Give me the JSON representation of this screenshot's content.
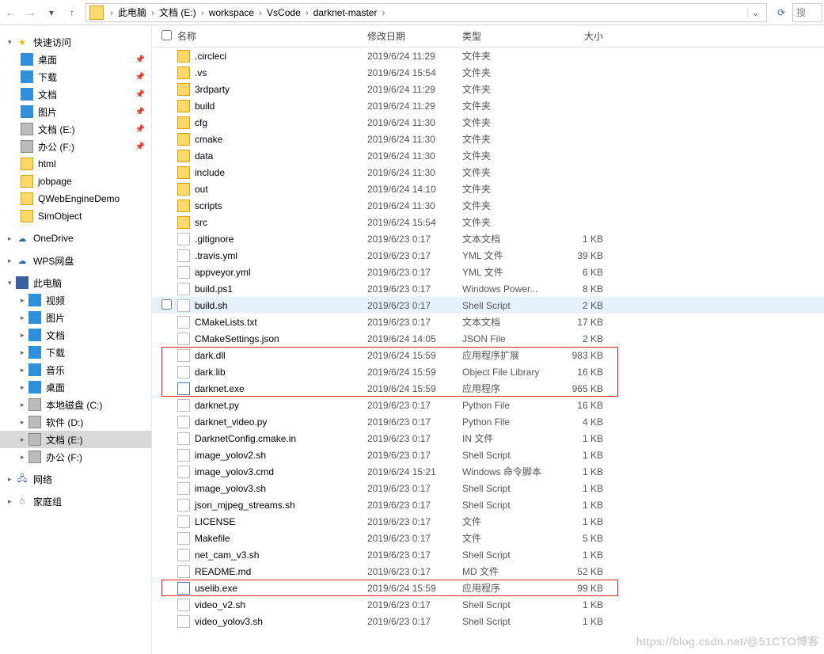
{
  "toolbar": {
    "breadcrumb": [
      "此电脑",
      "文档 (E:)",
      "workspace",
      "VsCode",
      "darknet-master"
    ],
    "search_placeholder": "搜索\""
  },
  "sidebar": {
    "quick_access": {
      "label": "快速访问",
      "items": [
        {
          "label": "桌面",
          "icon": "desktop",
          "pinned": true
        },
        {
          "label": "下载",
          "icon": "dl",
          "pinned": true
        },
        {
          "label": "文档",
          "icon": "doc",
          "pinned": true
        },
        {
          "label": "图片",
          "icon": "pic",
          "pinned": true
        },
        {
          "label": "文档 (E:)",
          "icon": "drive",
          "pinned": true
        },
        {
          "label": "办公 (F:)",
          "icon": "drive",
          "pinned": true
        },
        {
          "label": "html",
          "icon": "folder"
        },
        {
          "label": "jobpage",
          "icon": "folder"
        },
        {
          "label": "QWebEngineDemo",
          "icon": "folder"
        },
        {
          "label": "SimObject",
          "icon": "folder"
        }
      ]
    },
    "onedrive": {
      "label": "OneDrive"
    },
    "wps": {
      "label": "WPS网盘"
    },
    "this_pc": {
      "label": "此电脑",
      "items": [
        {
          "label": "视频",
          "icon": "pic"
        },
        {
          "label": "图片",
          "icon": "pic"
        },
        {
          "label": "文档",
          "icon": "doc"
        },
        {
          "label": "下载",
          "icon": "dl"
        },
        {
          "label": "音乐",
          "icon": "music"
        },
        {
          "label": "桌面",
          "icon": "desktop"
        },
        {
          "label": "本地磁盘 (C:)",
          "icon": "drive"
        },
        {
          "label": "软件 (D:)",
          "icon": "drive"
        },
        {
          "label": "文档 (E:)",
          "icon": "drive",
          "selected": true
        },
        {
          "label": "办公 (F:)",
          "icon": "drive"
        }
      ]
    },
    "network": {
      "label": "网络"
    },
    "homegroup": {
      "label": "家庭组"
    }
  },
  "columns": {
    "name": "名称",
    "date": "修改日期",
    "type": "类型",
    "size": "大小"
  },
  "files": [
    {
      "name": ".circleci",
      "date": "2019/6/24 11:29",
      "type": "文件夹",
      "size": "",
      "icon": "folder"
    },
    {
      "name": ".vs",
      "date": "2019/6/24 15:54",
      "type": "文件夹",
      "size": "",
      "icon": "folder"
    },
    {
      "name": "3rdparty",
      "date": "2019/6/24 11:29",
      "type": "文件夹",
      "size": "",
      "icon": "folder"
    },
    {
      "name": "build",
      "date": "2019/6/24 11:29",
      "type": "文件夹",
      "size": "",
      "icon": "folder"
    },
    {
      "name": "cfg",
      "date": "2019/6/24 11:30",
      "type": "文件夹",
      "size": "",
      "icon": "folder"
    },
    {
      "name": "cmake",
      "date": "2019/6/24 11:30",
      "type": "文件夹",
      "size": "",
      "icon": "folder"
    },
    {
      "name": "data",
      "date": "2019/6/24 11:30",
      "type": "文件夹",
      "size": "",
      "icon": "folder"
    },
    {
      "name": "include",
      "date": "2019/6/24 11:30",
      "type": "文件夹",
      "size": "",
      "icon": "folder"
    },
    {
      "name": "out",
      "date": "2019/6/24 14:10",
      "type": "文件夹",
      "size": "",
      "icon": "folder"
    },
    {
      "name": "scripts",
      "date": "2019/6/24 11:30",
      "type": "文件夹",
      "size": "",
      "icon": "folder"
    },
    {
      "name": "src",
      "date": "2019/6/24 15:54",
      "type": "文件夹",
      "size": "",
      "icon": "folder"
    },
    {
      "name": ".gitignore",
      "date": "2019/6/23 0:17",
      "type": "文本文档",
      "size": "1 KB",
      "icon": "txtfile"
    },
    {
      "name": ".travis.yml",
      "date": "2019/6/23 0:17",
      "type": "YML 文件",
      "size": "39 KB",
      "icon": "txtfile"
    },
    {
      "name": "appveyor.yml",
      "date": "2019/6/23 0:17",
      "type": "YML 文件",
      "size": "6 KB",
      "icon": "txtfile"
    },
    {
      "name": "build.ps1",
      "date": "2019/6/23 0:17",
      "type": "Windows Power...",
      "size": "8 KB",
      "icon": "shfile"
    },
    {
      "name": "build.sh",
      "date": "2019/6/23 0:17",
      "type": "Shell Script",
      "size": "2 KB",
      "icon": "shfile",
      "hovered": true
    },
    {
      "name": "CMakeLists.txt",
      "date": "2019/6/23 0:17",
      "type": "文本文档",
      "size": "17 KB",
      "icon": "txtfile"
    },
    {
      "name": "CMakeSettings.json",
      "date": "2019/6/24 14:05",
      "type": "JSON File",
      "size": "2 KB",
      "icon": "txtfile"
    },
    {
      "name": "dark.dll",
      "date": "2019/6/24 15:59",
      "type": "应用程序扩展",
      "size": "983 KB",
      "icon": "shfile"
    },
    {
      "name": "dark.lib",
      "date": "2019/6/24 15:59",
      "type": "Object File Library",
      "size": "16 KB",
      "icon": "shfile"
    },
    {
      "name": "darknet.exe",
      "date": "2019/6/24 15:59",
      "type": "应用程序",
      "size": "965 KB",
      "icon": "exefile"
    },
    {
      "name": "darknet.py",
      "date": "2019/6/23 0:17",
      "type": "Python File",
      "size": "16 KB",
      "icon": "txtfile"
    },
    {
      "name": "darknet_video.py",
      "date": "2019/6/23 0:17",
      "type": "Python File",
      "size": "4 KB",
      "icon": "txtfile"
    },
    {
      "name": "DarknetConfig.cmake.in",
      "date": "2019/6/23 0:17",
      "type": "IN 文件",
      "size": "1 KB",
      "icon": "txtfile"
    },
    {
      "name": "image_yolov2.sh",
      "date": "2019/6/23 0:17",
      "type": "Shell Script",
      "size": "1 KB",
      "icon": "shfile"
    },
    {
      "name": "image_yolov3.cmd",
      "date": "2019/6/24 15:21",
      "type": "Windows 命令脚本",
      "size": "1 KB",
      "icon": "shfile"
    },
    {
      "name": "image_yolov3.sh",
      "date": "2019/6/23 0:17",
      "type": "Shell Script",
      "size": "1 KB",
      "icon": "shfile"
    },
    {
      "name": "json_mjpeg_streams.sh",
      "date": "2019/6/23 0:17",
      "type": "Shell Script",
      "size": "1 KB",
      "icon": "shfile"
    },
    {
      "name": "LICENSE",
      "date": "2019/6/23 0:17",
      "type": "文件",
      "size": "1 KB",
      "icon": "txtfile"
    },
    {
      "name": "Makefile",
      "date": "2019/6/23 0:17",
      "type": "文件",
      "size": "5 KB",
      "icon": "txtfile"
    },
    {
      "name": "net_cam_v3.sh",
      "date": "2019/6/23 0:17",
      "type": "Shell Script",
      "size": "1 KB",
      "icon": "shfile"
    },
    {
      "name": "README.md",
      "date": "2019/6/23 0:17",
      "type": "MD 文件",
      "size": "52 KB",
      "icon": "txtfile"
    },
    {
      "name": "uselib.exe",
      "date": "2019/6/24 15:59",
      "type": "应用程序",
      "size": "99 KB",
      "icon": "exefile"
    },
    {
      "name": "video_v2.sh",
      "date": "2019/6/23 0:17",
      "type": "Shell Script",
      "size": "1 KB",
      "icon": "shfile"
    },
    {
      "name": "video_yolov3.sh",
      "date": "2019/6/23 0:17",
      "type": "Shell Script",
      "size": "1 KB",
      "icon": "shfile"
    }
  ],
  "highlights": [
    {
      "top_row": 18,
      "bottom_row": 20
    },
    {
      "top_row": 32,
      "bottom_row": 32
    }
  ],
  "watermark": "https://blog.csdn.net/@51CTO博客"
}
